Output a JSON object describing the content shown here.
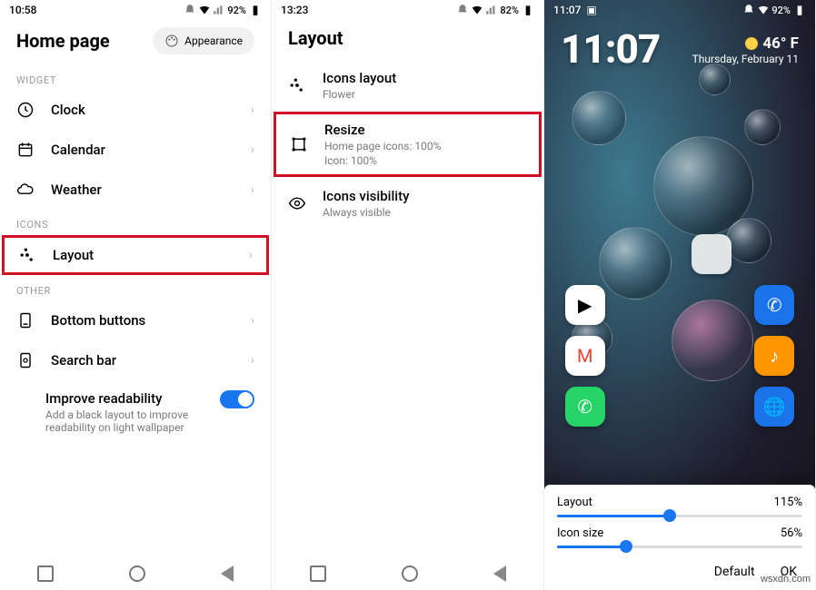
{
  "panel1": {
    "time": "10:58",
    "battery": "92%",
    "title": "Home page",
    "appearance": "Appearance",
    "sections": {
      "widget": "WIDGET",
      "icons": "ICONS",
      "other": "OTHER"
    },
    "rows": {
      "clock": "Clock",
      "calendar": "Calendar",
      "weather": "Weather",
      "layout": "Layout",
      "bottom_buttons": "Bottom buttons",
      "search_bar": "Search bar"
    },
    "improve": {
      "title": "Improve readability",
      "sub": "Add a black layout to improve readability on light wallpaper"
    }
  },
  "panel2": {
    "time": "13:23",
    "battery": "82%",
    "title": "Layout",
    "rows": {
      "icons_layout": {
        "label": "Icons layout",
        "sub": "Flower"
      },
      "resize": {
        "label": "Resize",
        "sub1": "Home page icons: 100%",
        "sub2": "Icon: 100%"
      },
      "visibility": {
        "label": "Icons visibility",
        "sub": "Always visible"
      }
    }
  },
  "panel3": {
    "time": "11:07",
    "battery": "92%",
    "clock": "11:07",
    "temp": "46° F",
    "date": "Thursday, February 11",
    "sheet": {
      "layout_label": "Layout",
      "layout_value": "115%",
      "layout_pct": 46,
      "icon_label": "Icon size",
      "icon_value": "56%",
      "icon_pct": 28,
      "default": "Default",
      "ok": "OK"
    }
  },
  "watermark": "wsxdn.com"
}
